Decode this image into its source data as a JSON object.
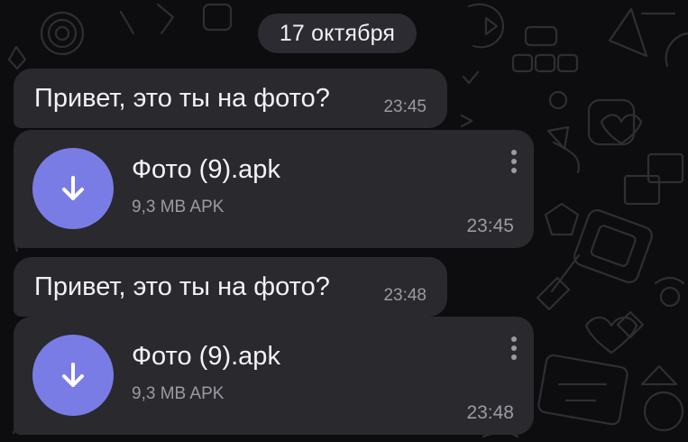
{
  "date_chip": "17 октября",
  "messages": [
    {
      "type": "text",
      "text": "Привет, это ты на фото?",
      "time": "23:45"
    },
    {
      "type": "file",
      "name": "Фото (9).apk",
      "meta": "9,3 MB APK",
      "time": "23:45",
      "icon": "download-arrow-icon"
    },
    {
      "type": "text",
      "text": "Привет, это ты на фото?",
      "time": "23:48"
    },
    {
      "type": "file",
      "name": "Фото (9).apk",
      "meta": "9,3 MB APK",
      "time": "23:48",
      "icon": "download-arrow-icon"
    }
  ],
  "colors": {
    "background": "#0d0d0f",
    "bubble": "#29292e",
    "accent": "#7a7ce6",
    "muted_text": "#9b9ba3"
  }
}
